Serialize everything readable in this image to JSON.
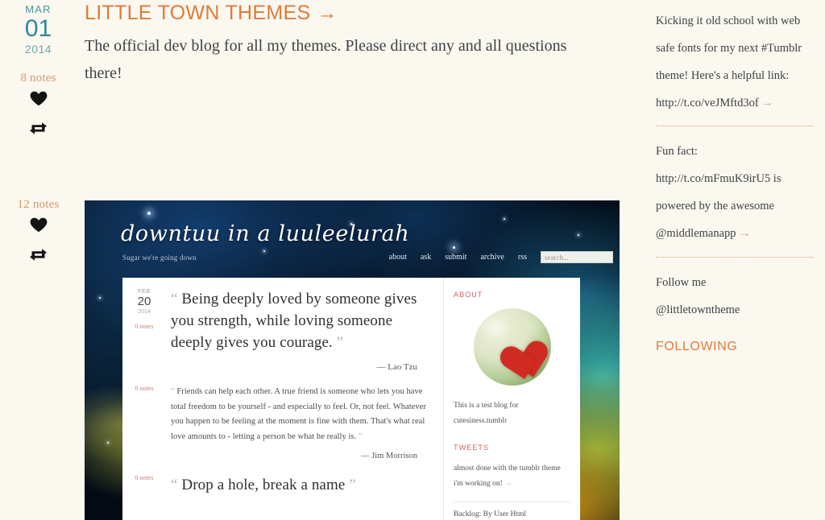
{
  "blog": {
    "title": "LITTLE TOWN THEMES",
    "title_arrow": "→",
    "description": "The official dev blog for all my themes. Please direct any and all questions there!"
  },
  "posts": [
    {
      "date": {
        "month": "MAR",
        "day": "01",
        "year": "2014"
      },
      "notes": "8 notes",
      "like_icon": "heart-icon",
      "reblog_icon": "reblog-icon"
    },
    {
      "notes": "12 notes",
      "like_icon": "heart-icon",
      "reblog_icon": "reblog-icon"
    }
  ],
  "embedded_screenshot": {
    "site_title": "downtuu in a luuleelurah",
    "tagline": "Sugar we're going down",
    "nav": [
      "about",
      "ask",
      "submit",
      "archive",
      "rss"
    ],
    "search": {
      "placeholder": "search..."
    },
    "quotes": [
      {
        "date": {
          "month": "FEB",
          "day": "20",
          "year": "2014"
        },
        "notes": "0 notes",
        "open_quote": "“",
        "close_quote": "”",
        "text": "Being deeply loved by someone gives you strength, while loving someone deeply gives you courage.",
        "source": "— Lao Tzu"
      },
      {
        "notes": "0 notes",
        "open_quote": "“",
        "close_quote": "”",
        "text": "Friends can help each other. A true friend is someone who lets you have total freedom to be yourself - and especially to feel. Or, not feel. Whatever you happen to be feeling at the moment is fine with them. That's what real love amounts to - letting a person be what he really is.",
        "source": "— Jim Morrison"
      },
      {
        "notes": "0 notes",
        "open_quote": "“",
        "close_quote": "”",
        "text": "Drop a hole, break a name",
        "source": ""
      }
    ],
    "aside": {
      "about_heading": "ABOUT",
      "avatar_icon": "heart-avatar-icon",
      "about_text": "This is a test blog for cutesiness.tumblr",
      "tweets_heading": "TWEETS",
      "tweet_text": "almost done with the tumblr theme i'm working on!",
      "tweet_arrow": "→",
      "backlog_text": "Backlog: By User Html"
    }
  },
  "sidebar": {
    "entries": [
      {
        "text": "Kicking it old school with web safe fonts for my next #Tumblr theme! Here's a helpful link:",
        "link": "http://t.co/veJMftd3of",
        "arrow": "→"
      },
      {
        "text": "Fun fact: http://t.co/mFmuK9irU5 is powered by the awesome",
        "link": "@middlemanapp",
        "arrow": "→"
      }
    ],
    "follow_label": "Follow me",
    "follow_handle": "@littletowntheme",
    "following_heading": "FOLLOWING"
  },
  "colors": {
    "background": "#faf8ef",
    "accent_orange": "#e07b39",
    "date_teal": "#2f87a0",
    "notes_tan": "#d99a6c",
    "rule_dotted": "#d9ab72",
    "embedded_notes": "#c2807f",
    "embedded_heading": "#d8605e"
  }
}
